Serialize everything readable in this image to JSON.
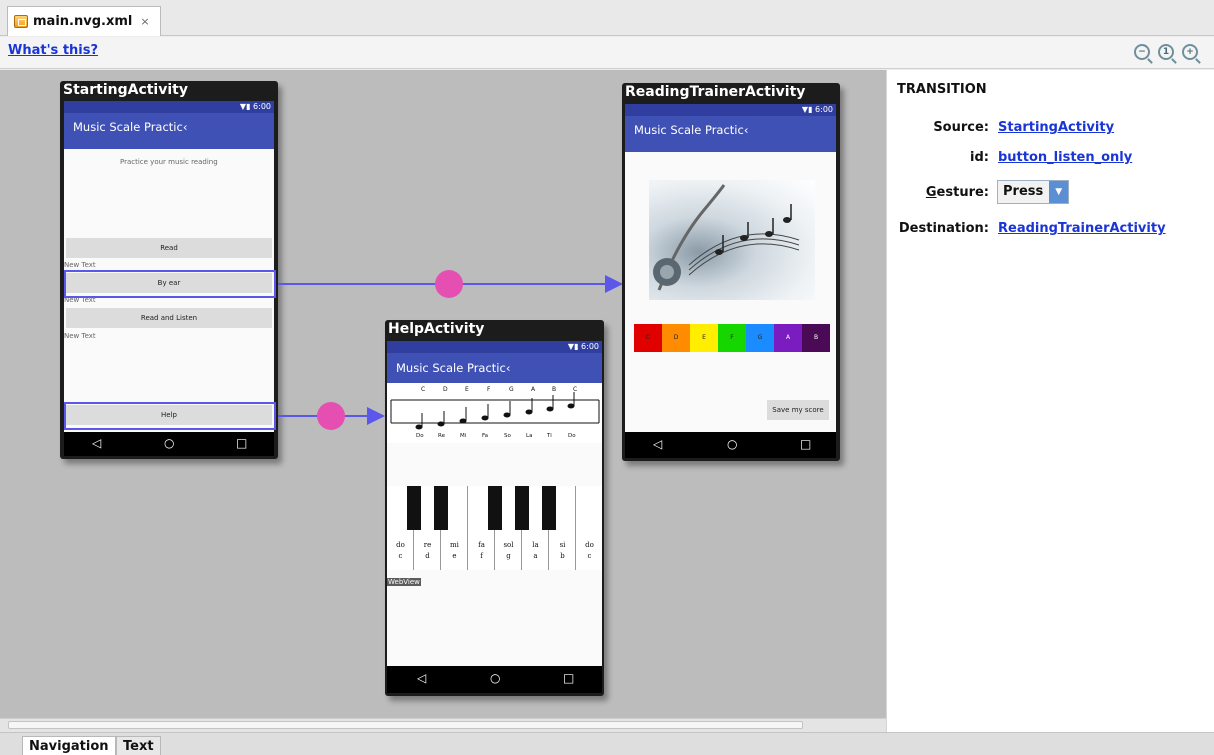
{
  "editor_tab": {
    "title": "main.nvg.xml",
    "close": "×"
  },
  "toolbar": {
    "whats_this": "What's this?"
  },
  "bottom_tabs": [
    "Navigation",
    "Text"
  ],
  "panel": {
    "title": "TRANSITION",
    "source_label": "Source:",
    "source_value": "StartingActivity",
    "id_label": "id:",
    "id_value": "button_listen_only",
    "gesture_label_mnemonic": "G",
    "gesture_label_rest": "esture:",
    "gesture_value": "Press",
    "destination_label": "Destination:",
    "destination_value": "ReadingTrainerActivity"
  },
  "status_time": "6:00",
  "app_title": "Music Scale Practic‹",
  "starting": {
    "title": "StartingActivity",
    "subtitle": "Practice your music reading",
    "btn_read": "Read",
    "new_text": "New Text",
    "btn_by_ear": "By ear",
    "btn_read_listen": "Read and Listen",
    "btn_help": "Help"
  },
  "reading": {
    "title": "ReadingTrainerActivity",
    "notes": [
      "C",
      "D",
      "E",
      "F",
      "G",
      "A",
      "B"
    ],
    "note_colors": [
      "#e00000",
      "#ff8c00",
      "#ffee00",
      "#16d600",
      "#1a8cff",
      "#7a1cc0",
      "#4a0a55"
    ],
    "save": "Save my score"
  },
  "help": {
    "title": "HelpActivity",
    "staff_letters": [
      "C",
      "D",
      "E",
      "F",
      "G",
      "A",
      "B",
      "C"
    ],
    "solfege": [
      "Do",
      "Re",
      "Mi",
      "Fa",
      "So",
      "La",
      "Ti",
      "Do"
    ],
    "keys_top": [
      "do",
      "re",
      "mi",
      "fa",
      "sol",
      "la",
      "si",
      "do"
    ],
    "keys_bottom": [
      "c",
      "d",
      "e",
      "f",
      "g",
      "a",
      "b",
      "c"
    ],
    "webview": "WebView"
  },
  "nav": {
    "back": "◁",
    "home": "○",
    "recent": "□"
  }
}
